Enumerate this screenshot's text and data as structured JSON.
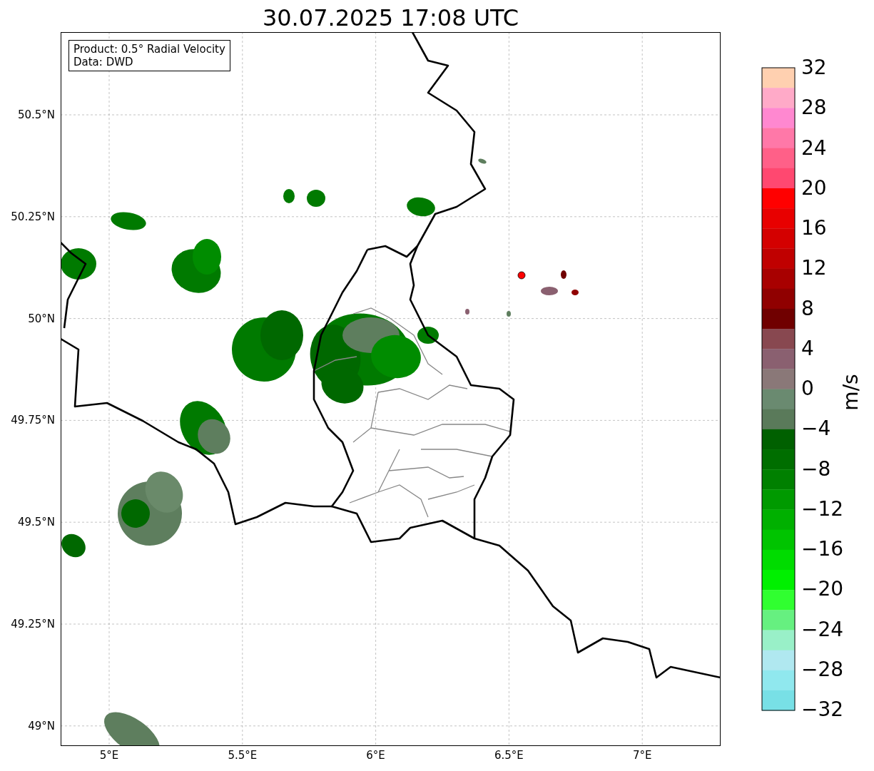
{
  "title": "30.07.2025 17:08 UTC",
  "info_box": {
    "lines": [
      "Product: 0.5° Radial Velocity",
      "Data: DWD"
    ]
  },
  "map": {
    "y_ticks": [
      "50.5°N",
      "50.25°N",
      "50°N",
      "49.75°N",
      "49.5°N",
      "49.25°N",
      "49°N"
    ],
    "x_ticks": [
      "5°E",
      "5.5°E",
      "6°E",
      "6.5°E",
      "7°E"
    ]
  },
  "colorbar": {
    "label": "m/s",
    "ticks": [
      "32",
      "28",
      "24",
      "20",
      "16",
      "12",
      "8",
      "4",
      "0",
      "−4",
      "−8",
      "−12",
      "−16",
      "−20",
      "−24",
      "−28",
      "−32"
    ]
  }
}
